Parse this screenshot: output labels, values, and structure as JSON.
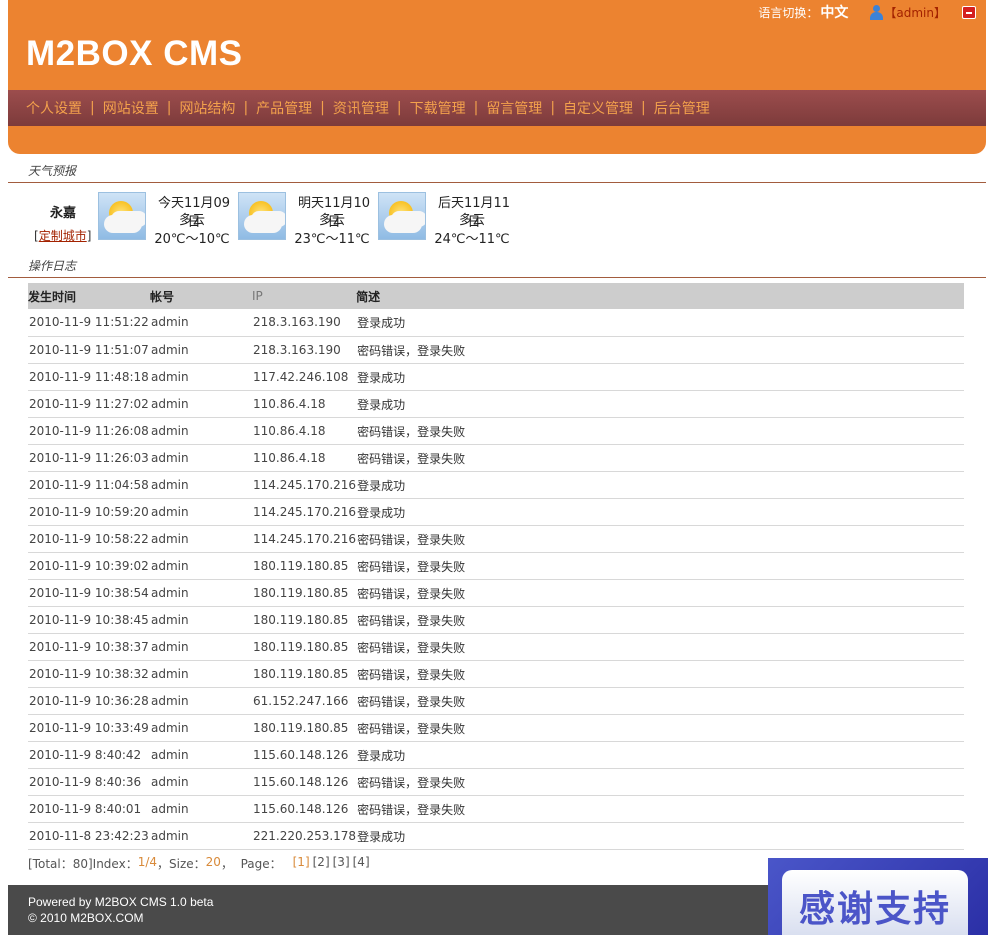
{
  "topbar": {
    "lang_label": "语言切换：",
    "lang_value": "中文",
    "user": "【admin】",
    "user_icon": "user-icon",
    "logout_icon": "logout-icon"
  },
  "logo": "M2BOX CMS",
  "nav": [
    "个人设置",
    "网站设置",
    "网站结构",
    "产品管理",
    "资讯管理",
    "下载管理",
    "留言管理",
    "自定义管理",
    "后台管理"
  ],
  "weather": {
    "title": "天气预报",
    "city": "永嘉",
    "custom_link": "定制城市",
    "days": [
      {
        "date": "今天11月09日",
        "condition": "多云",
        "temp": "20℃～10℃",
        "icon": "cloudy-sun-icon"
      },
      {
        "date": "明天11月10日",
        "condition": "多云",
        "temp": "23℃～11℃",
        "icon": "cloudy-sun-icon"
      },
      {
        "date": "后天11月11日",
        "condition": "多云",
        "temp": "24℃～11℃",
        "icon": "cloudy-sun-icon"
      }
    ]
  },
  "log": {
    "title": "操作日志",
    "headers": {
      "time": "发生时间",
      "account": "帐号",
      "ip": "IP",
      "desc": "简述"
    },
    "rows": [
      [
        "2010-11-9 11:51:22",
        "admin",
        "218.3.163.190",
        "登录成功"
      ],
      [
        "2010-11-9 11:51:07",
        "admin",
        "218.3.163.190",
        "密码错误，登录失败"
      ],
      [
        "2010-11-9 11:48:18",
        "admin",
        "117.42.246.108",
        "登录成功"
      ],
      [
        "2010-11-9 11:27:02",
        "admin",
        "110.86.4.18",
        "登录成功"
      ],
      [
        "2010-11-9 11:26:08",
        "admin",
        "110.86.4.18",
        "密码错误，登录失败"
      ],
      [
        "2010-11-9 11:26:03",
        "admin",
        "110.86.4.18",
        "密码错误，登录失败"
      ],
      [
        "2010-11-9 11:04:58",
        "admin",
        "114.245.170.216",
        "登录成功"
      ],
      [
        "2010-11-9 10:59:20",
        "admin",
        "114.245.170.216",
        "登录成功"
      ],
      [
        "2010-11-9 10:58:22",
        "admin",
        "114.245.170.216",
        "密码错误，登录失败"
      ],
      [
        "2010-11-9 10:39:02",
        "admin",
        "180.119.180.85",
        "密码错误，登录失败"
      ],
      [
        "2010-11-9 10:38:54",
        "admin",
        "180.119.180.85",
        "密码错误，登录失败"
      ],
      [
        "2010-11-9 10:38:45",
        "admin",
        "180.119.180.85",
        "密码错误，登录失败"
      ],
      [
        "2010-11-9 10:38:37",
        "admin",
        "180.119.180.85",
        "密码错误，登录失败"
      ],
      [
        "2010-11-9 10:38:32",
        "admin",
        "180.119.180.85",
        "密码错误，登录失败"
      ],
      [
        "2010-11-9 10:36:28",
        "admin",
        "61.152.247.166",
        "密码错误，登录失败"
      ],
      [
        "2010-11-9 10:33:49",
        "admin",
        "180.119.180.85",
        "密码错误，登录失败"
      ],
      [
        "2010-11-9 8:40:42",
        "admin",
        "115.60.148.126",
        "登录成功"
      ],
      [
        "2010-11-9 8:40:36",
        "admin",
        "115.60.148.126",
        "密码错误，登录失败"
      ],
      [
        "2010-11-9 8:40:01",
        "admin",
        "115.60.148.126",
        "密码错误，登录失败"
      ],
      [
        "2010-11-8 23:42:23",
        "admin",
        "221.220.253.178",
        "登录成功"
      ]
    ]
  },
  "pager": {
    "total_label": "[Total：80]Index：",
    "index": "1/4",
    "size_label": "，Size：",
    "size": "20",
    "page_label": "，  Page：",
    "pages": [
      "[1]",
      "[2]",
      "[3]",
      "[4]"
    ]
  },
  "footer": {
    "line1": "Powered by M2BOX CMS 1.0 beta",
    "line2": "© 2010 M2BOX.COM"
  },
  "thanks": "感谢支持",
  "colors": {
    "header": "#ec8330",
    "nav": "#8c4545",
    "nav_text": "#f3a14c",
    "footer": "#4a4a4a"
  }
}
